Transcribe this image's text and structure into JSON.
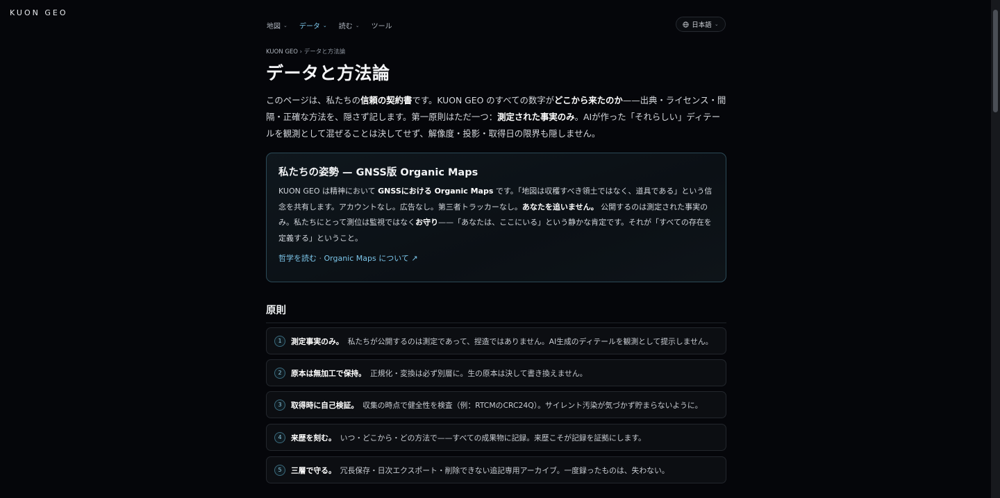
{
  "brand": "KUON GEO",
  "nav": [
    {
      "label": "地図",
      "dropdown": true,
      "active": false
    },
    {
      "label": "データ",
      "dropdown": true,
      "active": true
    },
    {
      "label": "読む",
      "dropdown": true,
      "active": false
    },
    {
      "label": "ツール",
      "dropdown": false,
      "active": false
    }
  ],
  "language": {
    "label": "日本語",
    "icon": "globe-icon"
  },
  "breadcrumb": {
    "home": "KUON GEO",
    "separator": "›",
    "current": "データと方法論"
  },
  "title": "データと方法論",
  "lead": {
    "t1": "このページは、私たちの",
    "b1": "信頼の契約書",
    "t2": "です。KUON GEO のすべての数字が",
    "b2": "どこから来たのか",
    "t3": "——出典・ライセンス・間隔・正確な方法を、隠さず記します。第一原則はただ一つ：",
    "b3": "測定された事実のみ",
    "t4": "。AIが作った「それらしい」ディテールを観測として混ぜることは決してせず、解像度・投影・取得日の限界も隠しません。"
  },
  "stance": {
    "title": "私たちの姿勢 — GNSS版 Organic Maps",
    "t1": "KUON GEO は精神において ",
    "b1": "GNSSにおける Organic Maps",
    "t2": " です。「地図は収穫すべき領土ではなく、道具である」という信念を共有します。アカウントなし。広告なし。第三者トラッカーなし。",
    "b2": "あなたを追いません。",
    "t3": " 公開するのは測定された事実のみ。私たちにとって測位は監視ではなく",
    "b3": "お守り",
    "t4": "——「あなたは、ここにいる」という静かな肯定です。それが「すべての存在を定義する」ということ。",
    "link1": "哲学を読む",
    "link_sep": "·",
    "link2": "Organic Maps について ↗"
  },
  "principles_title": "原則",
  "principles": [
    {
      "num": "1",
      "title": "測定事実のみ。",
      "text": "私たちが公開するのは測定であって、捏造ではありません。AI生成のディテールを観測として提示しません。"
    },
    {
      "num": "2",
      "title": "原本は無加工で保持。",
      "text": "正規化・変換は必ず別層に。生の原本は決して書き換えません。"
    },
    {
      "num": "3",
      "title": "取得時に自己検証。",
      "text": "収集の時点で健全性を検査（例：RTCMのCRC24Q）。サイレント汚染が気づかず貯まらないように。"
    },
    {
      "num": "4",
      "title": "来歴を刻む。",
      "text": "いつ・どこから・どの方法で——すべての成果物に記録。来歴こそが記録を証拠にします。"
    },
    {
      "num": "5",
      "title": "三層で守る。",
      "text": "冗長保存・日次エクスポート・削除できない追記専用アーカイブ。一度録ったものは、失わない。"
    }
  ],
  "colors": {
    "background": "#05060a",
    "accent": "#7cc6ea",
    "card_border": "#2c4a57"
  }
}
